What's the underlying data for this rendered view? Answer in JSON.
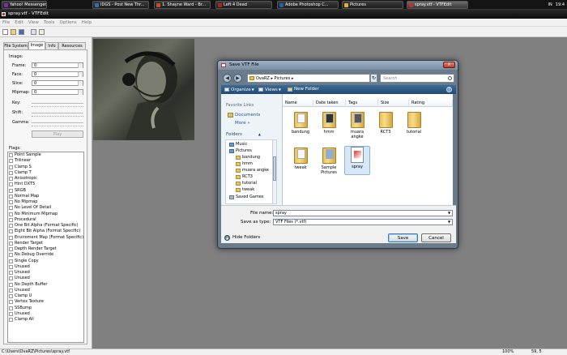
{
  "taskbar": {
    "buttons": [
      {
        "label": "Yahoo! Messenger",
        "color": "#7b2aa8"
      },
      {
        "label": "IDGS - Post New Thr...",
        "color": "#3a6ab0"
      },
      {
        "label": "1. Shayne Ward - Br...",
        "color": "#c84a2a"
      },
      {
        "label": "Left 4 Dead",
        "color": "#b02020"
      },
      {
        "label": "Adobe Photoshop C...",
        "color": "#2a5ab0"
      },
      {
        "label": "Pictures",
        "color": "#e0b040"
      },
      {
        "label": "spray.vtf - VTFEdit",
        "color": "#c03030"
      }
    ],
    "tray": {
      "lang": "IN",
      "time": "19:4"
    }
  },
  "window": {
    "title": "spray.vtf - VTFEdit"
  },
  "menu": [
    "File",
    "Edit",
    "View",
    "Tools",
    "Options",
    "Help"
  ],
  "left": {
    "tabs": [
      "File System",
      "Image",
      "Info",
      "Resources"
    ],
    "image_group": "Image:",
    "fields": [
      {
        "label": "Frame:",
        "value": "0"
      },
      {
        "label": "Face:",
        "value": "0"
      },
      {
        "label": "Slice:",
        "value": "0"
      },
      {
        "label": "Mipmap:",
        "value": "0"
      }
    ],
    "key_label": "Key:",
    "shift_label": "Shift:",
    "gamma_label": "Gamma:",
    "play_label": "Play",
    "flags_label": "Flags:",
    "flags": [
      "Point Sample",
      "Trilinear",
      "Clamp S",
      "Clamp T",
      "Anisotropic",
      "Hint DXT5",
      "SRGB",
      "Normal Map",
      "No Mipmap",
      "No Level Of Detail",
      "No Minimum Mipmap",
      "Procedural",
      "One Bit Alpha (Format Specific)",
      "Eight Bit Alpha (Format Specific)",
      "Enviroment Map (Format Specific)",
      "Render Target",
      "Depth Render Target",
      "No Debug Override",
      "Single Copy",
      "Unused",
      "Unused",
      "Unused",
      "No Depth Buffer",
      "Unused",
      "Clamp U",
      "Vertex Texture",
      "SSBump",
      "Unused",
      "Clamp All"
    ]
  },
  "dialog": {
    "title": "Save VTF File",
    "close": "X",
    "back": "◀",
    "forward": "▶",
    "breadcrumb": "OvaRZ ▸ Pictures ▸",
    "refresh": "↻",
    "search_placeholder": "Search",
    "commands": {
      "organize": "Organize",
      "views": "Views",
      "new_folder": "New Folder"
    },
    "fav_head": "Favorite Links",
    "favorites": [
      "Documents"
    ],
    "more": "More »",
    "folders_head": "Folders",
    "tree": [
      "Music",
      "Pictures",
      "bandung",
      "hmm",
      "muara angke",
      "RCT3",
      "tutorial",
      "tweak",
      "Saved Games"
    ],
    "columns": [
      "Name",
      "Date taken",
      "Tags",
      "Size",
      "Rating"
    ],
    "items": [
      "bandung",
      "hmm",
      "muara angke",
      "RCT3",
      "tutorial",
      "tweak",
      "Sample Pictures",
      "spray"
    ],
    "filename_label": "File name:",
    "filename_value": "spray",
    "savetype_label": "Save as type:",
    "savetype_value": "VTF Files (*.vtf)",
    "hide_folders": "Hide Folders",
    "save": "Save",
    "cancel": "Cancel"
  },
  "status": {
    "path": "C:\\Users\\OvaRZ\\Pictures\\spray.vtf",
    "zoom": "100%",
    "coords": "59, 5"
  }
}
